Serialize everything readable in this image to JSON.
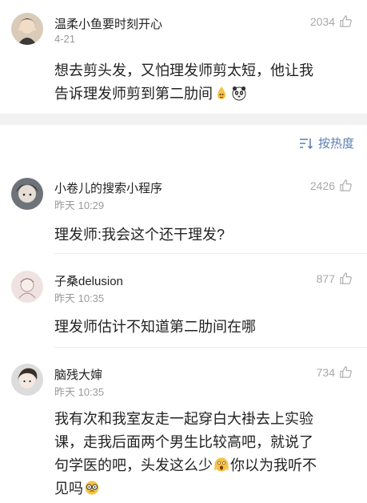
{
  "post": {
    "author": "温柔小鱼要时刻开心",
    "date": "4-21",
    "likes": "2034",
    "text_line1": "想去剪头发，又怕理发师剪太短，他让我",
    "text_line2": "告诉理发师剪到第二肋间"
  },
  "sort": {
    "label": "按热度",
    "icon": "sort-lines-icon"
  },
  "comments": [
    {
      "author": "小卷儿的搜索小程序",
      "time": "昨天 10:29",
      "likes": "2426",
      "text_lines": [
        "理发师:我会这个还干理发?"
      ]
    },
    {
      "author": "子桑delusion",
      "time": "昨天 10:35",
      "likes": "877",
      "text_lines": [
        "理发师估计不知道第二肋间在哪"
      ]
    },
    {
      "author": "脑残大婶",
      "time": "昨天 10:35",
      "likes": "734",
      "text_lines": [
        "我有次和我室友走一起穿白大褂去上实验",
        "课，走我后面两个男生比较高吧，就说了",
        "句学医的吧，头发这么少",
        "你以为我听不",
        "见吗"
      ]
    }
  ],
  "colors": {
    "accent": "#5a7fb0",
    "muted": "#9a9a9a",
    "band": "#f2f2f2"
  }
}
